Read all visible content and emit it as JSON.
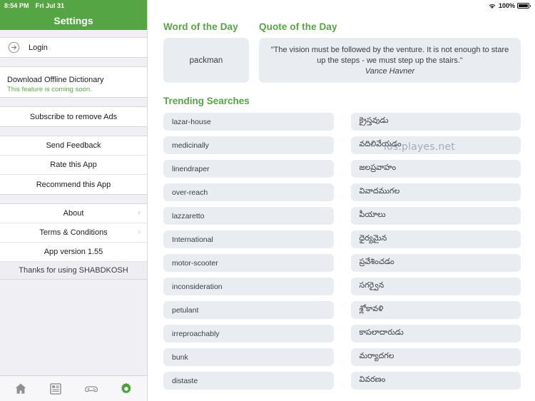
{
  "statusbar": {
    "time": "8:54 PM",
    "date": "Fri Jul 31",
    "battery_percent": "100%",
    "wifi_icon": "wifi-icon",
    "battery_icon": "battery-full-icon"
  },
  "sidebar": {
    "title": "Settings",
    "login": {
      "label": "Login",
      "icon": "sign-in-arrow-circle-icon"
    },
    "download": {
      "label": "Download Offline Dictionary",
      "sublabel": "This feature is coming soon."
    },
    "subscribe": {
      "label": "Subscribe to remove Ads"
    },
    "feedback_group": [
      {
        "label": "Send Feedback"
      },
      {
        "label": "Rate this App"
      },
      {
        "label": "Recommend this App"
      }
    ],
    "info_group": [
      {
        "label": "About",
        "chevron": "›"
      },
      {
        "label": "Terms & Conditions",
        "chevron": "›"
      },
      {
        "label": "App version 1.55",
        "chevron": ""
      }
    ],
    "thanks": "Thanks for using SHABDKOSH"
  },
  "tabbar": {
    "items": [
      {
        "name": "home",
        "icon": "home-icon",
        "active": false
      },
      {
        "name": "news",
        "icon": "article-list-icon",
        "active": false
      },
      {
        "name": "games",
        "icon": "game-controller-icon",
        "active": false
      },
      {
        "name": "settings",
        "icon": "gear-icon",
        "active": true
      }
    ],
    "active_color": "#45a132",
    "inactive_color": "#8e8e93"
  },
  "main": {
    "word_of_the_day": {
      "heading": "Word of the Day",
      "word": "packman"
    },
    "quote_of_the_day": {
      "heading": "Quote of the Day",
      "text": "\"The vision must be followed by the venture. It is not enough to stare up the steps - we must step up the stairs.\"",
      "author": "Vance Havner"
    },
    "trending": {
      "heading": "Trending Searches",
      "left_column": [
        "lazar-house",
        "medicinally",
        "linendraper",
        "over-reach",
        "lazzaretto",
        "International",
        "motor-scooter",
        "inconsideration",
        "petulant",
        "irreproachably",
        "bunk",
        "distaste"
      ],
      "right_column": [
        "క్రైస్తవుడు",
        "వదిలివేయడం",
        "జలప్రవాహం",
        "వివాదముగల",
        "పీయాలు",
        "ధైర్యమైన",
        "ప్రవేశించడం",
        "సగర్వైన",
        "శ్లోకావళి",
        "కాపలాదారుడు",
        "మర్యాదగల",
        "వివరణం"
      ]
    },
    "watermark": "ios.playes.net"
  },
  "colors": {
    "brand_green": "#56a544",
    "pill_bg": "#e9ecf1",
    "sidebar_bg": "#efeff4"
  }
}
